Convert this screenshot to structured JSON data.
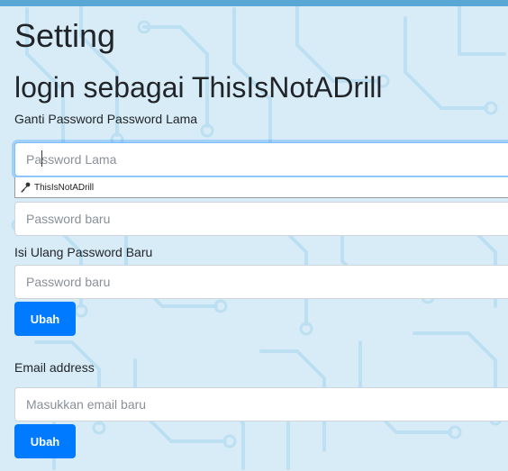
{
  "page": {
    "title": "Setting",
    "login_as": "login sebagai ThisIsNotADrill"
  },
  "password_form": {
    "label_old": "Ganti Password Password Lama",
    "old_placeholder": "Password Lama",
    "autofill_user": "ThisIsNotADrill",
    "new_placeholder": "Password baru",
    "label_repeat": "Isi Ulang Password Baru",
    "repeat_placeholder": "Password baru",
    "submit_label": "Ubah"
  },
  "email_form": {
    "label": "Email address",
    "placeholder": "Masukkan email baru",
    "submit_label": "Ubah"
  },
  "colors": {
    "background": "#d7ecf7",
    "circuit": "#bcdff1",
    "primary": "#007bff",
    "top_bar": "#5aa7d6"
  },
  "icons": {
    "autofill": "key-icon"
  }
}
